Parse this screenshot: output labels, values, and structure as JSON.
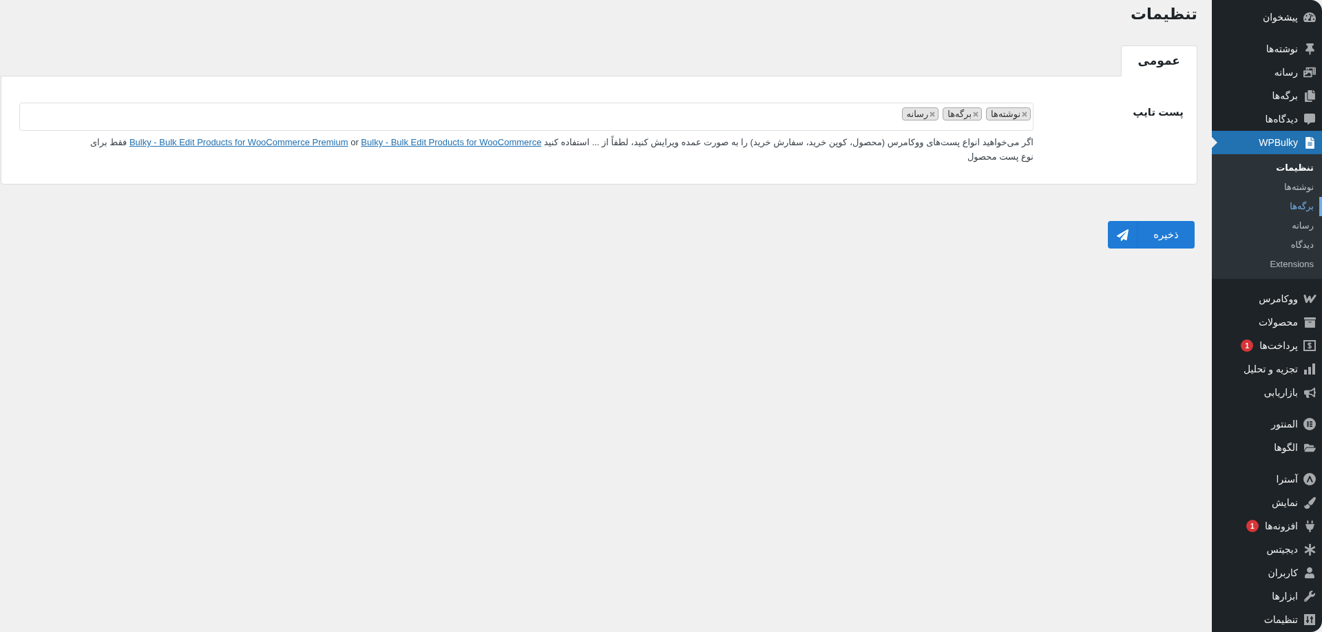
{
  "page_title": "تنظیمات",
  "tabs": [
    {
      "label": "عمومی",
      "selected": true
    }
  ],
  "settings": {
    "label": "پست تایپ",
    "post_types": [
      "نوشته‌ها",
      "برگه‌ها",
      "رسانه"
    ],
    "description": {
      "text": "اگر می‌خواهید انواع پست‌های ووکامرس (محصول، کوپن خرید، سفارش خرید) را به صورت عمده ویرایش کنید، لطفاً از ... استفاده کنید",
      "links": [
        "Bulky - Bulk Edit Products for WooCommerce",
        "Bulky - Bulk Edit Products for WooCommerce Premium"
      ],
      "joiner": "or",
      "tail": "فقط برای",
      "line_2": "نوع پست محصول"
    }
  },
  "save_button": "ذخیره",
  "sidebar": {
    "groups": [
      {
        "items": [
          {
            "label": "پیشخوان",
            "selected": false
          }
        ]
      },
      {
        "items": [
          {
            "label": "نوشته‌ها",
            "selected": false
          },
          {
            "label": "رسانه",
            "selected": false
          },
          {
            "label": "برگه‌ها",
            "selected": false
          },
          {
            "label": "دیدگاه‌ها",
            "selected": false
          },
          {
            "label": "WPBulky",
            "selected": true,
            "submenu": [
              {
                "label": "تنظیمات",
                "selected": true,
                "highlighted": false
              },
              {
                "label": "نوشته‌ها",
                "selected": false,
                "highlighted": false
              },
              {
                "label": "برگه‌ها",
                "selected": false,
                "highlighted": true
              },
              {
                "label": "رسانه",
                "selected": false,
                "highlighted": false
              },
              {
                "label": "دیدگاه",
                "selected": false,
                "highlighted": false
              },
              {
                "label": "Extensions",
                "selected": false,
                "highlighted": false
              }
            ]
          }
        ]
      },
      {
        "items": [
          {
            "label": "ووکامرس",
            "selected": false
          },
          {
            "label": "محصولات",
            "selected": false
          },
          {
            "label": "پرداخت‌ها",
            "selected": false,
            "badge": "1"
          },
          {
            "label": "تجزیه و تحلیل",
            "selected": false
          },
          {
            "label": "بازاریابی",
            "selected": false
          }
        ]
      },
      {
        "items": [
          {
            "label": "المنتور",
            "selected": false
          },
          {
            "label": "الگوها",
            "selected": false
          }
        ]
      },
      {
        "items": [
          {
            "label": "آسترا",
            "selected": false
          },
          {
            "label": "نمایش",
            "selected": false
          },
          {
            "label": "افزونه‌ها",
            "selected": false,
            "badge": "1"
          },
          {
            "label": "دیجیتس",
            "selected": false
          },
          {
            "label": "کاربران",
            "selected": false
          },
          {
            "label": "ابزارها",
            "selected": false
          },
          {
            "label": "تنظیمات",
            "selected": false
          }
        ]
      }
    ]
  }
}
